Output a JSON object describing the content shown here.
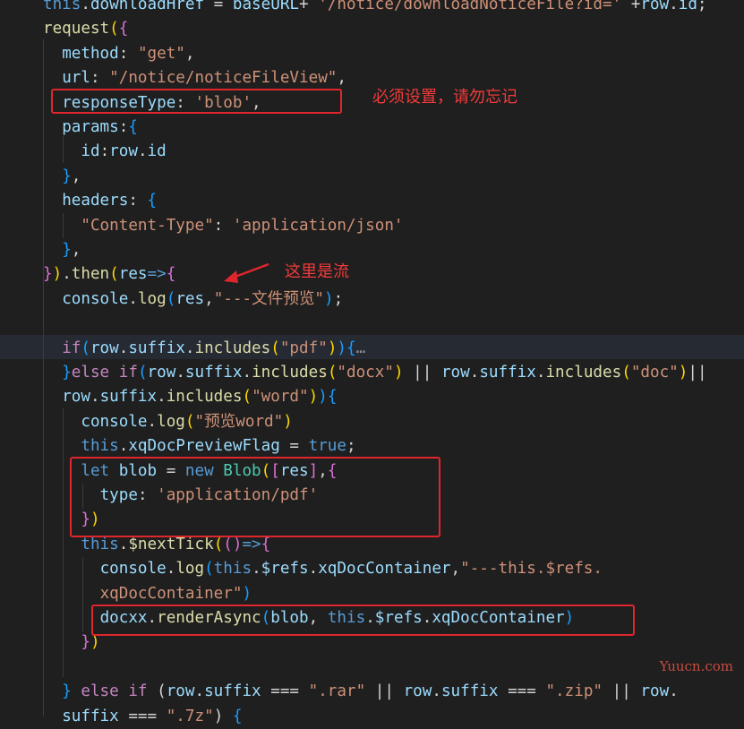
{
  "annotations": {
    "response_type_note": "必须设置，请勿忘记",
    "stream_note": "这里是流",
    "watermark": "Yuucn.com"
  },
  "code_lines": [
    [
      {
        "t": "this",
        "c": "kw"
      },
      {
        "t": ".",
        "c": "plain"
      },
      {
        "t": "downloadHref",
        "c": "prop"
      },
      {
        "t": " = ",
        "c": "plain"
      },
      {
        "t": "baseURL",
        "c": "prop"
      },
      {
        "t": "+ ",
        "c": "plain"
      },
      {
        "t": "'/notice/downloadNoticeFile?id='",
        "c": "str"
      },
      {
        "t": " +",
        "c": "plain"
      },
      {
        "t": "row",
        "c": "prop"
      },
      {
        "t": ".",
        "c": "plain"
      },
      {
        "t": "id",
        "c": "prop"
      },
      {
        "t": ";",
        "c": "plain"
      }
    ],
    [
      {
        "t": "request",
        "c": "fn"
      },
      {
        "t": "(",
        "c": "b1"
      },
      {
        "t": "{",
        "c": "b2"
      }
    ],
    [
      {
        "t": "  ",
        "c": "plain"
      },
      {
        "t": "method",
        "c": "prop"
      },
      {
        "t": ": ",
        "c": "plain"
      },
      {
        "t": "\"get\"",
        "c": "str"
      },
      {
        "t": ",",
        "c": "plain"
      }
    ],
    [
      {
        "t": "  ",
        "c": "plain"
      },
      {
        "t": "url",
        "c": "prop"
      },
      {
        "t": ": ",
        "c": "plain"
      },
      {
        "t": "\"/notice/noticeFileView\"",
        "c": "str"
      },
      {
        "t": ",",
        "c": "plain"
      }
    ],
    [
      {
        "t": "  ",
        "c": "plain"
      },
      {
        "t": "responseType",
        "c": "prop"
      },
      {
        "t": ": ",
        "c": "plain"
      },
      {
        "t": "'blob'",
        "c": "str"
      },
      {
        "t": ",",
        "c": "plain"
      }
    ],
    [
      {
        "t": "  ",
        "c": "plain"
      },
      {
        "t": "params",
        "c": "prop"
      },
      {
        "t": ":",
        "c": "plain"
      },
      {
        "t": "{",
        "c": "b3"
      }
    ],
    [
      {
        "t": "    ",
        "c": "plain"
      },
      {
        "t": "id",
        "c": "prop"
      },
      {
        "t": ":",
        "c": "plain"
      },
      {
        "t": "row",
        "c": "prop"
      },
      {
        "t": ".",
        "c": "plain"
      },
      {
        "t": "id",
        "c": "prop"
      }
    ],
    [
      {
        "t": "  ",
        "c": "plain"
      },
      {
        "t": "}",
        "c": "b3"
      },
      {
        "t": ",",
        "c": "plain"
      }
    ],
    [
      {
        "t": "  ",
        "c": "plain"
      },
      {
        "t": "headers",
        "c": "prop"
      },
      {
        "t": ": ",
        "c": "plain"
      },
      {
        "t": "{",
        "c": "b3"
      }
    ],
    [
      {
        "t": "    ",
        "c": "plain"
      },
      {
        "t": "\"Content-Type\"",
        "c": "str"
      },
      {
        "t": ": ",
        "c": "plain"
      },
      {
        "t": "'application/json'",
        "c": "str"
      }
    ],
    [
      {
        "t": "  ",
        "c": "plain"
      },
      {
        "t": "}",
        "c": "b3"
      },
      {
        "t": ",",
        "c": "plain"
      }
    ],
    [
      {
        "t": "}",
        "c": "b2"
      },
      {
        "t": ")",
        "c": "b1"
      },
      {
        "t": ".",
        "c": "plain"
      },
      {
        "t": "then",
        "c": "fn"
      },
      {
        "t": "(",
        "c": "b1"
      },
      {
        "t": "res",
        "c": "prop"
      },
      {
        "t": "=>",
        "c": "kw"
      },
      {
        "t": "{",
        "c": "b2"
      }
    ],
    [
      {
        "t": "  ",
        "c": "plain"
      },
      {
        "t": "console",
        "c": "prop"
      },
      {
        "t": ".",
        "c": "plain"
      },
      {
        "t": "log",
        "c": "fn"
      },
      {
        "t": "(",
        "c": "b3"
      },
      {
        "t": "res",
        "c": "prop"
      },
      {
        "t": ",",
        "c": "plain"
      },
      {
        "t": "\"---文件预览\"",
        "c": "str"
      },
      {
        "t": ")",
        "c": "b3"
      },
      {
        "t": ";",
        "c": "plain"
      }
    ],
    [],
    [
      {
        "t": "  ",
        "c": "plain"
      },
      {
        "t": "if",
        "c": "ctl"
      },
      {
        "t": "(",
        "c": "b3"
      },
      {
        "t": "row",
        "c": "prop"
      },
      {
        "t": ".",
        "c": "plain"
      },
      {
        "t": "suffix",
        "c": "prop"
      },
      {
        "t": ".",
        "c": "plain"
      },
      {
        "t": "includes",
        "c": "fn"
      },
      {
        "t": "(",
        "c": "b1"
      },
      {
        "t": "\"pdf\"",
        "c": "str"
      },
      {
        "t": ")",
        "c": "b1"
      },
      {
        "t": ")",
        "c": "b3"
      },
      {
        "t": "{",
        "c": "b3"
      },
      {
        "t": "…",
        "c": "fold"
      }
    ],
    [
      {
        "t": "  ",
        "c": "plain"
      },
      {
        "t": "}",
        "c": "b3"
      },
      {
        "t": "else ",
        "c": "ctl"
      },
      {
        "t": "if",
        "c": "ctl"
      },
      {
        "t": "(",
        "c": "b3"
      },
      {
        "t": "row",
        "c": "prop"
      },
      {
        "t": ".",
        "c": "plain"
      },
      {
        "t": "suffix",
        "c": "prop"
      },
      {
        "t": ".",
        "c": "plain"
      },
      {
        "t": "includes",
        "c": "fn"
      },
      {
        "t": "(",
        "c": "b1"
      },
      {
        "t": "\"docx\"",
        "c": "str"
      },
      {
        "t": ")",
        "c": "b1"
      },
      {
        "t": " || ",
        "c": "plain"
      },
      {
        "t": "row",
        "c": "prop"
      },
      {
        "t": ".",
        "c": "plain"
      },
      {
        "t": "suffix",
        "c": "prop"
      },
      {
        "t": ".",
        "c": "plain"
      },
      {
        "t": "includes",
        "c": "fn"
      },
      {
        "t": "(",
        "c": "b1"
      },
      {
        "t": "\"doc\"",
        "c": "str"
      },
      {
        "t": ")",
        "c": "b1"
      },
      {
        "t": "||",
        "c": "plain"
      }
    ],
    [
      {
        "t": "  ",
        "c": "plain"
      },
      {
        "t": "row",
        "c": "prop"
      },
      {
        "t": ".",
        "c": "plain"
      },
      {
        "t": "suffix",
        "c": "prop"
      },
      {
        "t": ".",
        "c": "plain"
      },
      {
        "t": "includes",
        "c": "fn"
      },
      {
        "t": "(",
        "c": "b1"
      },
      {
        "t": "\"word\"",
        "c": "str"
      },
      {
        "t": ")",
        "c": "b1"
      },
      {
        "t": ")",
        "c": "b3"
      },
      {
        "t": "{",
        "c": "b3"
      }
    ],
    [
      {
        "t": "    ",
        "c": "plain"
      },
      {
        "t": "console",
        "c": "prop"
      },
      {
        "t": ".",
        "c": "plain"
      },
      {
        "t": "log",
        "c": "fn"
      },
      {
        "t": "(",
        "c": "b1"
      },
      {
        "t": "\"预览word\"",
        "c": "str"
      },
      {
        "t": ")",
        "c": "b1"
      }
    ],
    [
      {
        "t": "    ",
        "c": "plain"
      },
      {
        "t": "this",
        "c": "kw"
      },
      {
        "t": ".",
        "c": "plain"
      },
      {
        "t": "xqDocPreviewFlag",
        "c": "prop"
      },
      {
        "t": " = ",
        "c": "plain"
      },
      {
        "t": "true",
        "c": "kw"
      },
      {
        "t": ";",
        "c": "plain"
      }
    ],
    [
      {
        "t": "    ",
        "c": "plain"
      },
      {
        "t": "let ",
        "c": "kw"
      },
      {
        "t": "blob",
        "c": "prop"
      },
      {
        "t": " = ",
        "c": "plain"
      },
      {
        "t": "new ",
        "c": "kw"
      },
      {
        "t": "Blob",
        "c": "cls"
      },
      {
        "t": "(",
        "c": "b1"
      },
      {
        "t": "[",
        "c": "b2"
      },
      {
        "t": "res",
        "c": "prop"
      },
      {
        "t": "]",
        "c": "b2"
      },
      {
        "t": ",",
        "c": "plain"
      },
      {
        "t": "{",
        "c": "b2"
      }
    ],
    [
      {
        "t": "      ",
        "c": "plain"
      },
      {
        "t": "type",
        "c": "prop"
      },
      {
        "t": ": ",
        "c": "plain"
      },
      {
        "t": "'application/pdf'",
        "c": "str"
      }
    ],
    [
      {
        "t": "    ",
        "c": "plain"
      },
      {
        "t": "}",
        "c": "b2"
      },
      {
        "t": ")",
        "c": "b1"
      }
    ],
    [
      {
        "t": "    ",
        "c": "plain"
      },
      {
        "t": "this",
        "c": "kw"
      },
      {
        "t": ".",
        "c": "plain"
      },
      {
        "t": "$nextTick",
        "c": "fn"
      },
      {
        "t": "(",
        "c": "b1"
      },
      {
        "t": "(",
        "c": "b2"
      },
      {
        "t": ")",
        "c": "b2"
      },
      {
        "t": "=>",
        "c": "kw"
      },
      {
        "t": "{",
        "c": "b2"
      }
    ],
    [
      {
        "t": "      ",
        "c": "plain"
      },
      {
        "t": "console",
        "c": "prop"
      },
      {
        "t": ".",
        "c": "plain"
      },
      {
        "t": "log",
        "c": "fn"
      },
      {
        "t": "(",
        "c": "b3"
      },
      {
        "t": "this",
        "c": "kw"
      },
      {
        "t": ".",
        "c": "plain"
      },
      {
        "t": "$refs",
        "c": "prop"
      },
      {
        "t": ".",
        "c": "plain"
      },
      {
        "t": "xqDocContainer",
        "c": "prop"
      },
      {
        "t": ",",
        "c": "plain"
      },
      {
        "t": "\"---this.$refs.",
        "c": "str"
      }
    ],
    [
      {
        "t": "      ",
        "c": "plain"
      },
      {
        "t": "xqDocContainer\"",
        "c": "str"
      },
      {
        "t": ")",
        "c": "b3"
      }
    ],
    [
      {
        "t": "      ",
        "c": "plain"
      },
      {
        "t": "docxx",
        "c": "prop"
      },
      {
        "t": ".",
        "c": "plain"
      },
      {
        "t": "renderAsync",
        "c": "fn"
      },
      {
        "t": "(",
        "c": "b3"
      },
      {
        "t": "blob",
        "c": "prop"
      },
      {
        "t": ", ",
        "c": "plain"
      },
      {
        "t": "this",
        "c": "kw"
      },
      {
        "t": ".",
        "c": "plain"
      },
      {
        "t": "$refs",
        "c": "prop"
      },
      {
        "t": ".",
        "c": "plain"
      },
      {
        "t": "xqDocContainer",
        "c": "prop"
      },
      {
        "t": ")",
        "c": "b3"
      }
    ],
    [
      {
        "t": "    ",
        "c": "plain"
      },
      {
        "t": "}",
        "c": "b2"
      },
      {
        "t": ")",
        "c": "b1"
      }
    ],
    [],
    [
      {
        "t": "  ",
        "c": "plain"
      },
      {
        "t": "}",
        "c": "b3"
      },
      {
        "t": " else ",
        "c": "ctl"
      },
      {
        "t": "if",
        "c": "ctl"
      },
      {
        "t": " (",
        "c": "plain"
      },
      {
        "t": "row",
        "c": "prop"
      },
      {
        "t": ".",
        "c": "plain"
      },
      {
        "t": "suffix",
        "c": "prop"
      },
      {
        "t": " === ",
        "c": "plain"
      },
      {
        "t": "\".rar\"",
        "c": "str"
      },
      {
        "t": " || ",
        "c": "plain"
      },
      {
        "t": "row",
        "c": "prop"
      },
      {
        "t": ".",
        "c": "plain"
      },
      {
        "t": "suffix",
        "c": "prop"
      },
      {
        "t": " === ",
        "c": "plain"
      },
      {
        "t": "\".zip\"",
        "c": "str"
      },
      {
        "t": " || ",
        "c": "plain"
      },
      {
        "t": "row",
        "c": "prop"
      },
      {
        "t": ".",
        "c": "plain"
      }
    ],
    [
      {
        "t": "  ",
        "c": "plain"
      },
      {
        "t": "suffix",
        "c": "prop"
      },
      {
        "t": " === ",
        "c": "plain"
      },
      {
        "t": "\".7z\"",
        "c": "str"
      },
      {
        "t": ") ",
        "c": "plain"
      },
      {
        "t": "{",
        "c": "b3"
      }
    ]
  ]
}
